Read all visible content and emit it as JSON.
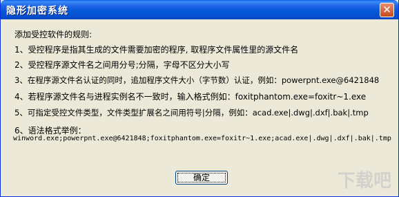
{
  "window": {
    "title": "隐形加密系统",
    "close_glyph": "✕"
  },
  "content": {
    "heading": "添加受控软件的规则:",
    "rules": [
      "1、受控程序是指其生成的文件需要加密的程序, 取程序文件属性里的源文件名",
      "2、受控程序源文件名之间用分号;分隔，字母不区分大小写",
      "3、在程序源文件名认证的同时，追加程序文件大小（字节数）认证，例如：powerpnt.exe@6421848",
      "4、若程序源文件名与进程实例名不一致时，输入格式例如：foxitphantom.exe=foxitr~1.exe",
      "5、可指定受控文件类型，文件类型扩展名之间用符号|分隔，例如：acad.exe|.dwg|.dxf|.bak|.tmp",
      "6、语法格式举例："
    ],
    "example": "winword.exe;powerpnt.exe@6421848;foxitphantom.exe=foxitr~1.exe;acad.exe|.dwg|.dxf|.bak|.tmp"
  },
  "buttons": {
    "ok": "确定"
  },
  "watermark": "下载吧"
}
